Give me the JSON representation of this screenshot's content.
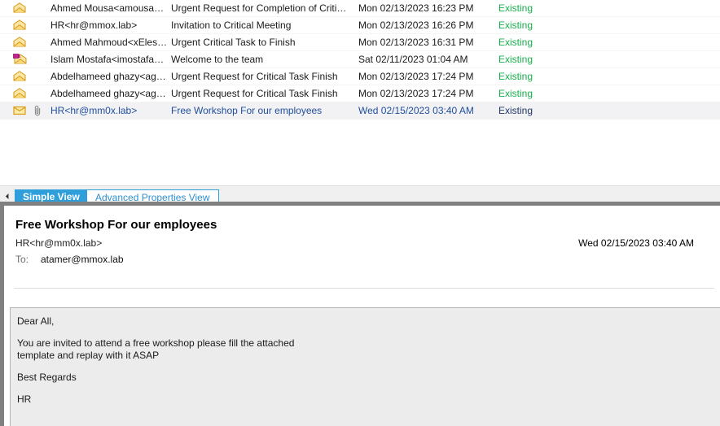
{
  "message_list": {
    "columns": [
      "icon",
      "attachment",
      "from",
      "subject",
      "received",
      "status"
    ],
    "rows": [
      {
        "icon": "open-envelope-icon",
        "attachment": "",
        "from": "Ahmed Mousa<amousa@m...",
        "subject": "Urgent Request for Completion of Critic...",
        "received": "Mon 02/13/2023 16:23 PM",
        "status": "Existing",
        "selected": false
      },
      {
        "icon": "open-envelope-icon",
        "attachment": "",
        "from": "HR<hr@mmox.lab>",
        "subject": "Invitation to Critical Meeting",
        "received": "Mon 02/13/2023 16:26 PM",
        "status": "Existing",
        "selected": false
      },
      {
        "icon": "open-envelope-icon",
        "attachment": "",
        "from": "Ahmed Mahmoud<xElessaw...",
        "subject": "Urgent Critical Task to Finish",
        "received": "Mon 02/13/2023 16:31 PM",
        "status": "Existing",
        "selected": false
      },
      {
        "icon": "replied-envelope-icon",
        "attachment": "",
        "from": "Islam Mostafa<imostafa@m...",
        "subject": "Welcome to the team",
        "received": "Sat 02/11/2023 01:04 AM",
        "status": "Existing",
        "selected": false
      },
      {
        "icon": "open-envelope-icon",
        "attachment": "",
        "from": "Abdelhameed ghazy<aghaz...",
        "subject": "Urgent Request for Critical Task Finish",
        "received": "Mon 02/13/2023 17:24 PM",
        "status": "Existing",
        "selected": false
      },
      {
        "icon": "open-envelope-icon",
        "attachment": "",
        "from": "Abdelhameed ghazy<aghaz...",
        "subject": "Urgent Request for Critical Task Finish",
        "received": "Mon 02/13/2023 17:24 PM",
        "status": "Existing",
        "selected": false
      },
      {
        "icon": "closed-envelope-icon",
        "attachment": "paperclip-icon",
        "from": "HR<hr@mm0x.lab>",
        "subject": "Free Workshop For our employees",
        "received": "Wed 02/15/2023 03:40 AM",
        "status": "Existing",
        "selected": true
      }
    ]
  },
  "tabs": {
    "collapse_label": "⏴",
    "items": [
      {
        "label": "Simple View",
        "active": true
      },
      {
        "label": "Advanced Properties View",
        "active": false
      }
    ]
  },
  "reading_pane": {
    "subject": "Free Workshop For our employees",
    "sender": "HR<hr@mm0x.lab>",
    "date": "Wed 02/15/2023 03:40 AM",
    "to_label": "To:",
    "to_value": "atamer@mmox.lab",
    "body_paragraphs": [
      "Dear All,",
      "You are invited to attend a free workshop please fill the attached\ntemplate and replay with it ASAP",
      "Best Regards",
      "HR"
    ]
  },
  "colors": {
    "status_existing": "#16b04b",
    "status_existing_selected": "#1f3864",
    "tab_active_bg": "#2f9fdc",
    "tab_inactive_text": "#2f8fd0",
    "selected_row_bg": "#f2f2f5",
    "selected_row_text": "#1f4e9c",
    "body_bg": "#ececec",
    "splitter_bg": "#808080"
  }
}
